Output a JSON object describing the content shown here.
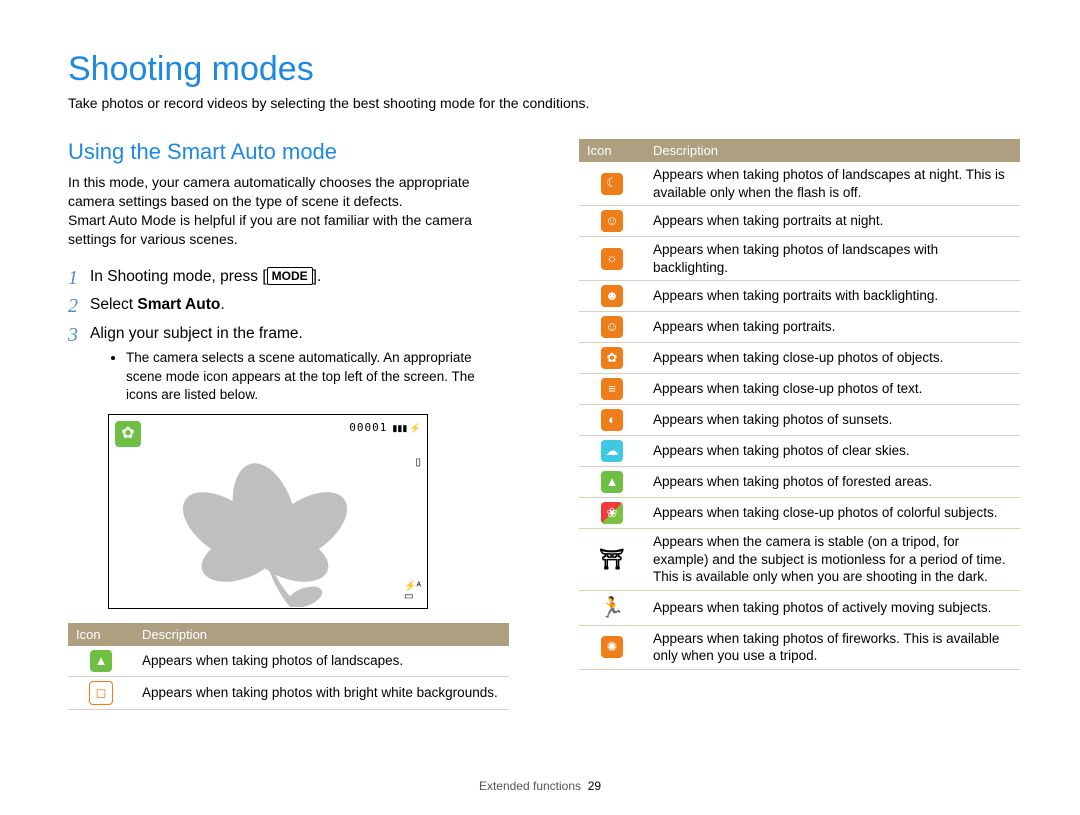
{
  "title": "Shooting modes",
  "subtitle": "Take photos or record videos by selecting the best shooting mode for the conditions.",
  "section_heading": "Using the Smart Auto mode",
  "intro": "In this mode, your camera automatically chooses the appropriate camera settings based on the type of scene it defects.\nSmart Auto Mode is helpful if you are not familiar with the camera settings for various scenes.",
  "steps": {
    "s1_pre": "In Shooting mode, press [",
    "s1_key": "MODE",
    "s1_post": "].",
    "s2_pre": "Select ",
    "s2_bold": "Smart Auto",
    "s2_post": ".",
    "s3": "Align your subject in the frame.",
    "s3_bullet": "The camera selects a scene automatically. An appropriate scene mode icon appears at the top left of the screen. The icons are listed below."
  },
  "screen": {
    "counter": "00001"
  },
  "table_headers": {
    "icon": "Icon",
    "desc": "Description"
  },
  "left_table": [
    {
      "icon_name": "landscape-icon",
      "bg": "green",
      "glyph": "▲",
      "desc": "Appears when taking photos of landscapes."
    },
    {
      "icon_name": "white-bg-icon",
      "bg": "white-bg",
      "glyph": "◻",
      "desc": "Appears when taking photos with bright white backgrounds."
    }
  ],
  "right_table": [
    {
      "icon_name": "night-landscape-icon",
      "bg": "orange",
      "glyph": "☾",
      "desc": "Appears when taking photos of landscapes at night. This is available only when the flash is off."
    },
    {
      "icon_name": "night-portrait-icon",
      "bg": "orange",
      "glyph": "☺",
      "desc": "Appears when taking portraits at night."
    },
    {
      "icon_name": "backlight-landscape-icon",
      "bg": "orange",
      "glyph": "☼",
      "desc": "Appears when taking photos of landscapes with backlighting."
    },
    {
      "icon_name": "backlight-portrait-icon",
      "bg": "orange",
      "glyph": "☻",
      "desc": "Appears when taking portraits with backlighting."
    },
    {
      "icon_name": "portrait-icon",
      "bg": "orange",
      "glyph": "☺",
      "desc": "Appears when taking portraits."
    },
    {
      "icon_name": "macro-icon",
      "bg": "orange",
      "glyph": "✿",
      "desc": "Appears when taking close-up photos of objects."
    },
    {
      "icon_name": "macro-text-icon",
      "bg": "orange",
      "glyph": "≡",
      "desc": "Appears when taking close-up photos of text."
    },
    {
      "icon_name": "sunset-icon",
      "bg": "orange",
      "glyph": "◐",
      "desc": "Appears when taking photos of sunsets."
    },
    {
      "icon_name": "clear-sky-icon",
      "bg": "cyan",
      "glyph": "☁",
      "desc": "Appears when taking photos of clear skies."
    },
    {
      "icon_name": "forest-icon",
      "bg": "green",
      "glyph": "▲",
      "desc": "Appears when taking photos of forested areas."
    },
    {
      "icon_name": "macro-color-icon",
      "bg": "multi",
      "glyph": "❀",
      "desc": "Appears when taking close-up photos of colorful subjects."
    },
    {
      "icon_name": "tripod-icon",
      "bg": "black",
      "glyph": "⛩",
      "desc": "Appears when the camera is stable (on a tripod, for example) and the subject is motionless for a period of time. This is available only when you are shooting in the dark."
    },
    {
      "icon_name": "action-icon",
      "bg": "black",
      "glyph": "🏃",
      "desc": "Appears when taking photos of actively moving subjects."
    },
    {
      "icon_name": "fireworks-icon",
      "bg": "orange",
      "glyph": "✺",
      "desc": "Appears when taking photos of fireworks. This is available only when you use a tripod."
    }
  ],
  "footer": {
    "label": "Extended functions",
    "page": "29"
  }
}
